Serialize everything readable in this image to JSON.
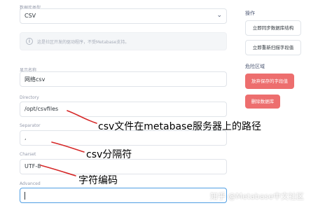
{
  "db_type": {
    "label": "数据库类型",
    "value": "CSV"
  },
  "info_notice": "这是社区开发的驱动程序，不受Metabase支持。",
  "display_name": {
    "label": "显示名称",
    "value": "网络csv"
  },
  "directory": {
    "label": "Directory",
    "value": "/opt/csvfiles"
  },
  "separator": {
    "label": "Separator",
    "value": ","
  },
  "charset": {
    "label": "Charset",
    "value": "UTF-8"
  },
  "advanced": {
    "label": "Advanced",
    "value": ""
  },
  "sidebar": {
    "actions_heading": "操作",
    "sync_button": "立即同步数据库结构",
    "rescan_button": "立即重新扫描字段值",
    "danger_heading": "危险区域",
    "discard_button": "放弃保存的字段值",
    "delete_button": "删除数据库"
  },
  "annotations": {
    "directory_note": "csv文件在metabase服务器上的路径",
    "separator_note": "csv分隔符",
    "charset_note": "字符编码"
  },
  "watermark": "知乎 @Metabase中文社区",
  "colors": {
    "danger": "#ed6e6e",
    "annotation_arrow": "#d62828",
    "focus": "#509ee3"
  }
}
